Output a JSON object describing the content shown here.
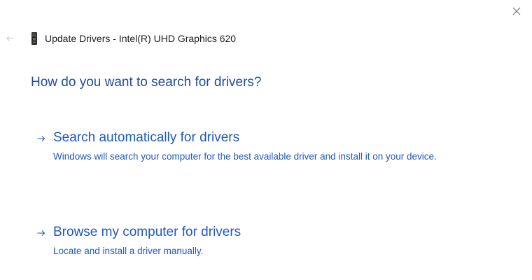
{
  "window": {
    "title": "Update Drivers - Intel(R) UHD Graphics 620"
  },
  "heading": "How do you want to search for drivers?",
  "options": [
    {
      "title": "Search automatically for drivers",
      "description": "Windows will search your computer for the best available driver and install it on your device."
    },
    {
      "title": "Browse my computer for drivers",
      "description": "Locate and install a driver manually."
    }
  ],
  "icons": {
    "close": "close-icon",
    "back": "back-arrow-icon",
    "device": "display-adapter-icon",
    "option_arrow": "arrow-right-icon"
  },
  "colors": {
    "heading": "#1f4a9b",
    "link": "#1f57c9",
    "title_text": "#1b1b1b",
    "background": "#ffffff"
  }
}
